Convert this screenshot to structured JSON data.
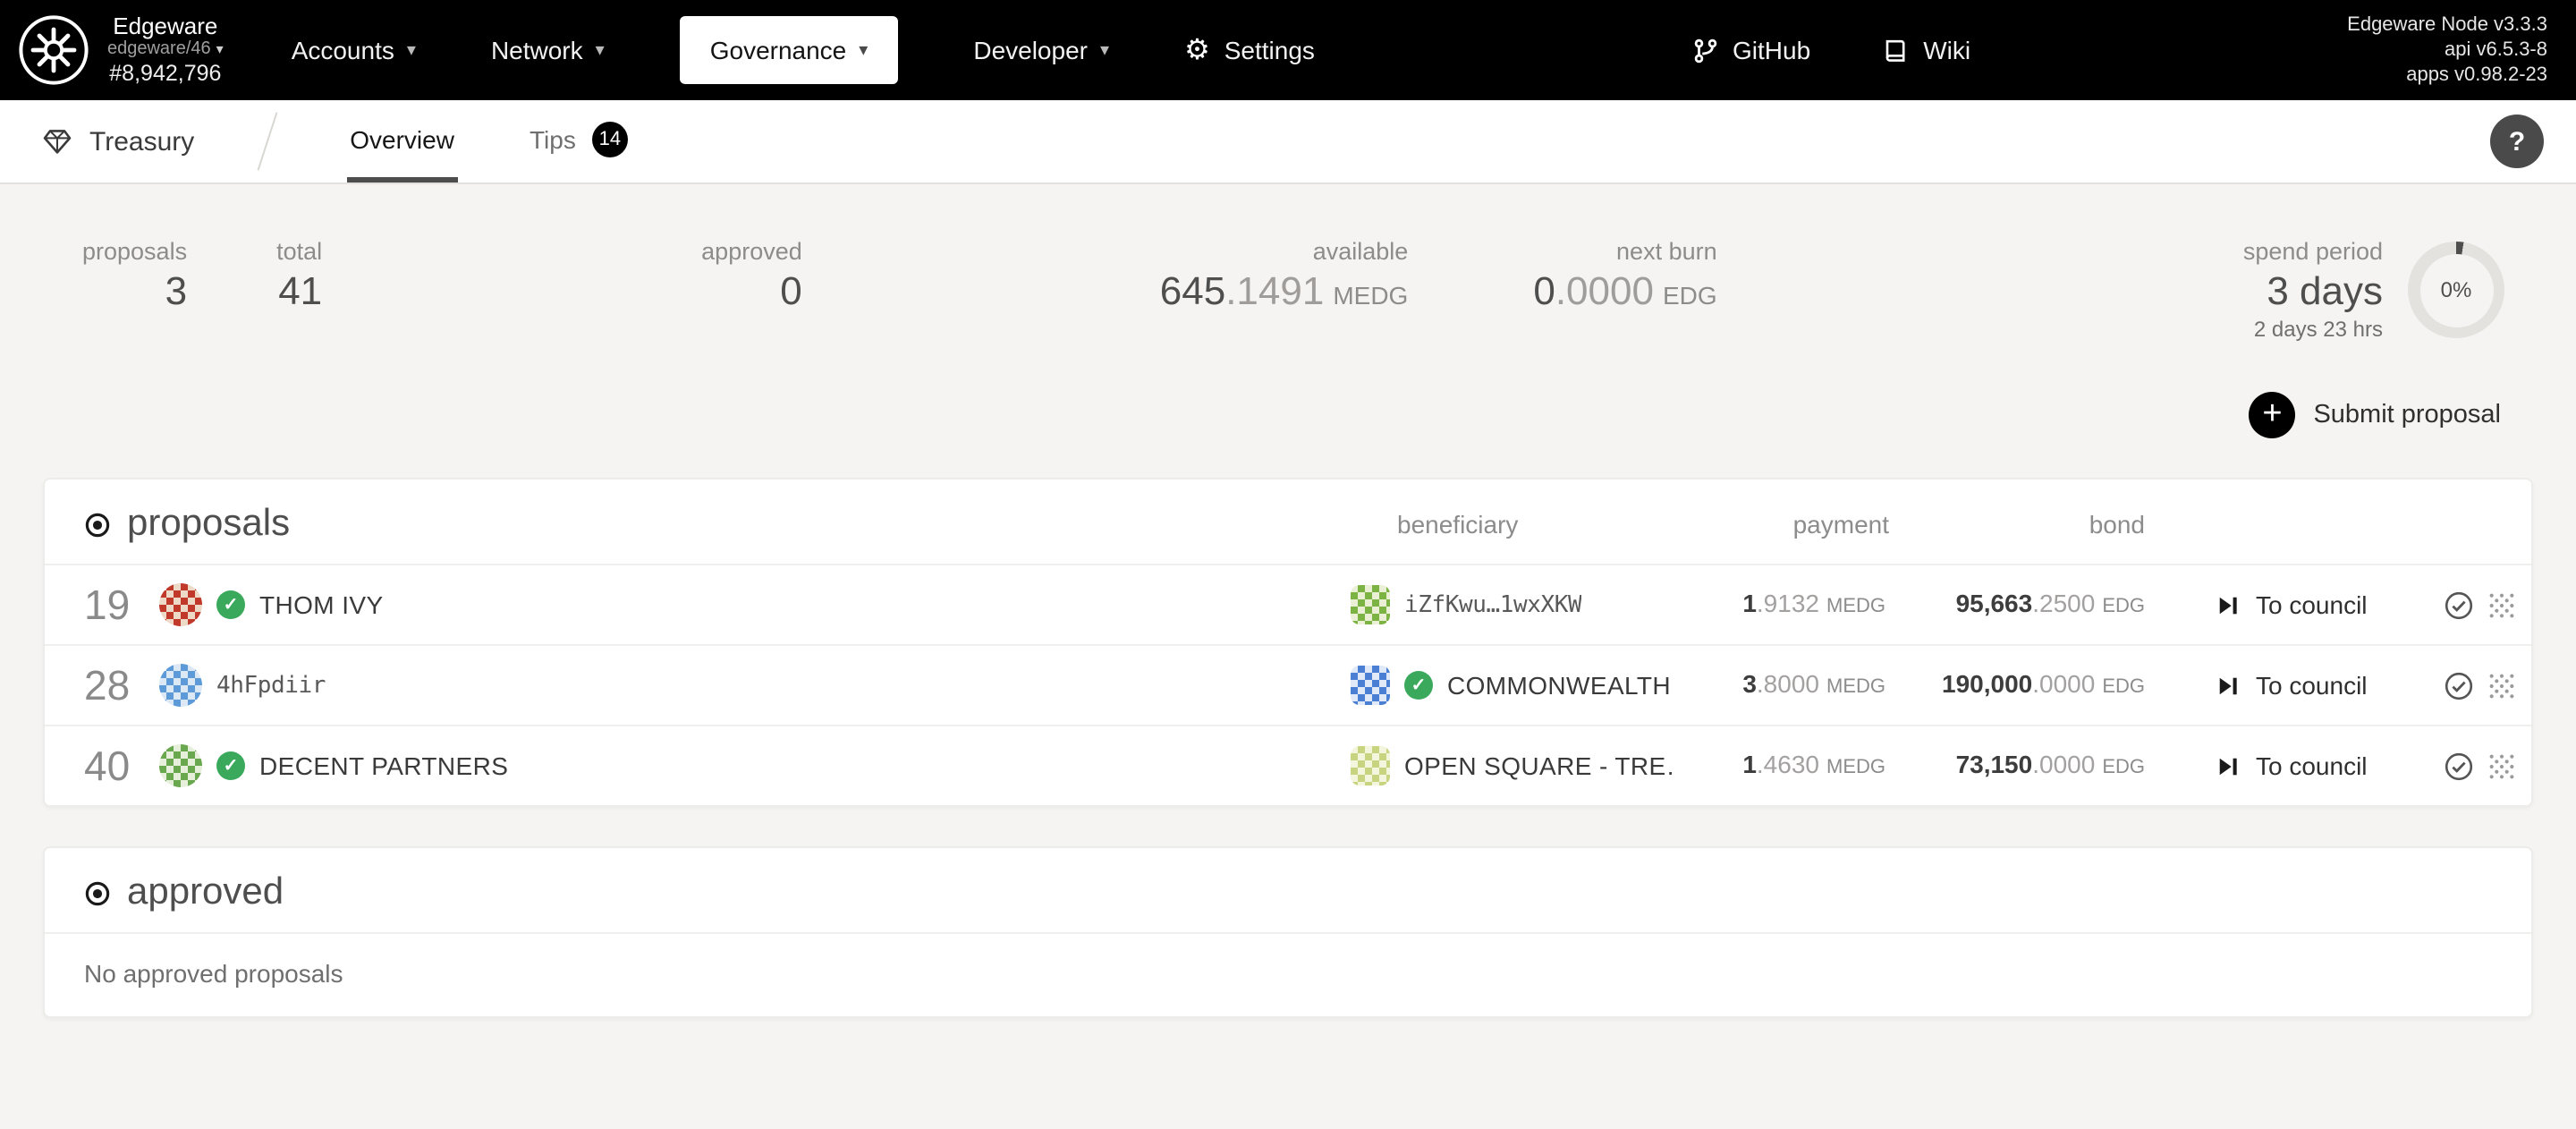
{
  "colors": {
    "topbar_bg": "#000000",
    "page_bg": "#f5f4f2",
    "card_bg": "#ffffff",
    "text_dark": "#4e4e4e",
    "text_gray": "#8c8c8c",
    "check_green": "#3aa95c"
  },
  "icons": {
    "chevron_down": "▾",
    "gear": "⚙",
    "help": "?",
    "plus": "+",
    "check": "✓"
  },
  "topbar": {
    "network": "Edgeware",
    "endpoint": "edgeware/46",
    "block_number": "#8,942,796",
    "menus": [
      {
        "label": "Accounts"
      },
      {
        "label": "Network"
      },
      {
        "label": "Governance",
        "active": true
      },
      {
        "label": "Developer"
      }
    ],
    "settings_label": "Settings",
    "github_label": "GitHub",
    "wiki_label": "Wiki",
    "versions": {
      "node": "Edgeware Node v3.3.3",
      "api": "api v6.5.3-8",
      "apps": "apps v0.98.2-23"
    }
  },
  "tabbar": {
    "section": "Treasury",
    "tabs": [
      {
        "label": "Overview",
        "active": true
      },
      {
        "label": "Tips",
        "badge": "14"
      }
    ]
  },
  "summary": {
    "proposals": {
      "label": "proposals",
      "value": "3"
    },
    "total": {
      "label": "total",
      "value": "41"
    },
    "approved": {
      "label": "approved",
      "value": "0"
    },
    "available": {
      "label": "available",
      "int": "645",
      "dec": ".1491",
      "unit": "MEDG"
    },
    "next_burn": {
      "label": "next burn",
      "int": "0",
      "dec": ".0000",
      "unit": "EDG"
    },
    "spend_period": {
      "label": "spend period",
      "value": "3 days",
      "elapsed": "2 days 23 hrs",
      "percent": "0%"
    }
  },
  "actions": {
    "submit_proposal": "Submit proposal"
  },
  "proposals_table": {
    "title": "proposals",
    "columns": {
      "beneficiary": "beneficiary",
      "payment": "payment",
      "bond": "bond"
    },
    "rows": [
      {
        "id": "19",
        "proposer": {
          "name": "THOM IVY"
        },
        "beneficiary": {
          "name": "iZfKwu…1wxXKW"
        },
        "payment": {
          "int": "1",
          "dec": ".9132",
          "unit": "MEDG"
        },
        "bond": {
          "int": "95,663",
          "dec": ".2500",
          "unit": "EDG"
        },
        "status": "To council"
      },
      {
        "id": "28",
        "proposer": {
          "name": "4hFpdiir"
        },
        "beneficiary": {
          "name": "COMMONWEALTH"
        },
        "payment": {
          "int": "3",
          "dec": ".8000",
          "unit": "MEDG"
        },
        "bond": {
          "int": "190,000",
          "dec": ".0000",
          "unit": "EDG"
        },
        "status": "To council"
      },
      {
        "id": "40",
        "proposer": {
          "name": "DECENT PARTNERS"
        },
        "beneficiary": {
          "name": "OPEN SQUARE - TRE…"
        },
        "payment": {
          "int": "1",
          "dec": ".4630",
          "unit": "MEDG"
        },
        "bond": {
          "int": "73,150",
          "dec": ".0000",
          "unit": "EDG"
        },
        "status": "To council"
      }
    ]
  },
  "approved_table": {
    "title": "approved",
    "empty_message": "No approved proposals"
  }
}
